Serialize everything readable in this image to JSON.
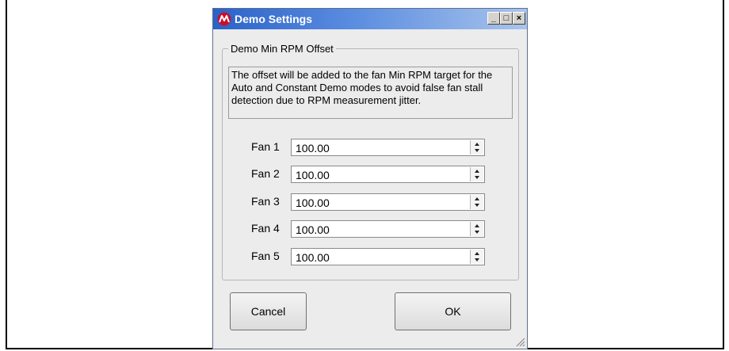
{
  "window": {
    "title": "Demo Settings",
    "controls": {
      "minimize": "_",
      "maximize": "□",
      "close": "×"
    }
  },
  "group": {
    "label": "Demo Min RPM Offset",
    "description": "The offset will be added to the fan Min RPM target for the Auto and Constant Demo modes to avoid false fan stall detection due to RPM measurement jitter."
  },
  "fans": [
    {
      "label": "Fan 1",
      "value": "100.00"
    },
    {
      "label": "Fan 2",
      "value": "100.00"
    },
    {
      "label": "Fan 3",
      "value": "100.00"
    },
    {
      "label": "Fan 4",
      "value": "100.00"
    },
    {
      "label": "Fan 5",
      "value": "100.00"
    }
  ],
  "buttons": {
    "cancel": "Cancel",
    "ok": "OK"
  },
  "icons": [
    "app-logo-icon",
    "minimize-icon",
    "maximize-icon",
    "close-icon",
    "spin-up-icon",
    "spin-down-icon",
    "resize-grip-icon"
  ]
}
